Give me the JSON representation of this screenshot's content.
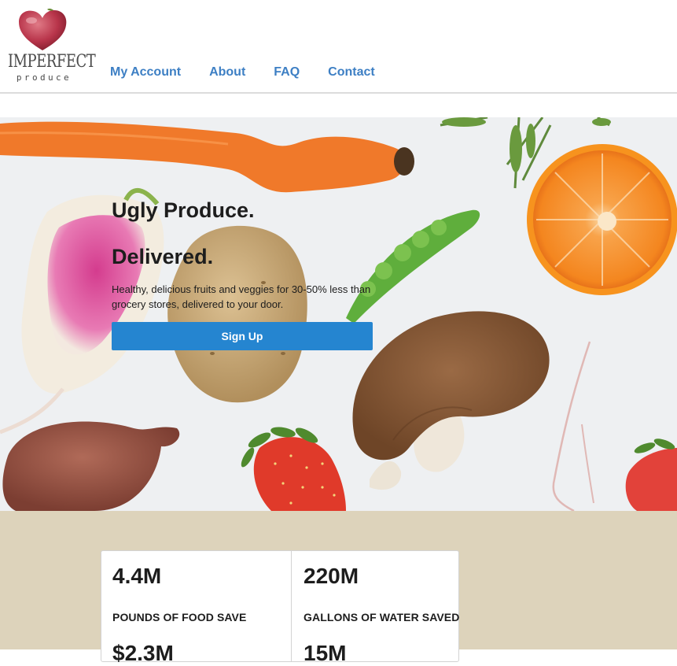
{
  "brand": {
    "logo_word1": "IMPERFECT",
    "logo_word2": "produce"
  },
  "nav": {
    "items": [
      {
        "label": "My Account"
      },
      {
        "label": "About"
      },
      {
        "label": "FAQ"
      },
      {
        "label": "Contact"
      }
    ]
  },
  "hero": {
    "title_line1": "Ugly Produce.",
    "title_line2": "Delivered.",
    "subtitle": "Healthy, delicious fruits and veggies for 30-50% less than grocery stores, delivered to your door.",
    "signup_label": "Sign Up"
  },
  "stats": [
    {
      "value": "4.4M",
      "label": "POUNDS OF FOOD SAVE"
    },
    {
      "value": "220M",
      "label": "GALLONS OF WATER SAVED"
    },
    {
      "value": "$2.3M",
      "label": ""
    },
    {
      "value": "15M",
      "label": ""
    }
  ],
  "colors": {
    "nav_link": "#3d7fc4",
    "signup_button": "#2585d0",
    "stats_background": "#ddd3bb",
    "hero_background": "#eef0f2"
  }
}
